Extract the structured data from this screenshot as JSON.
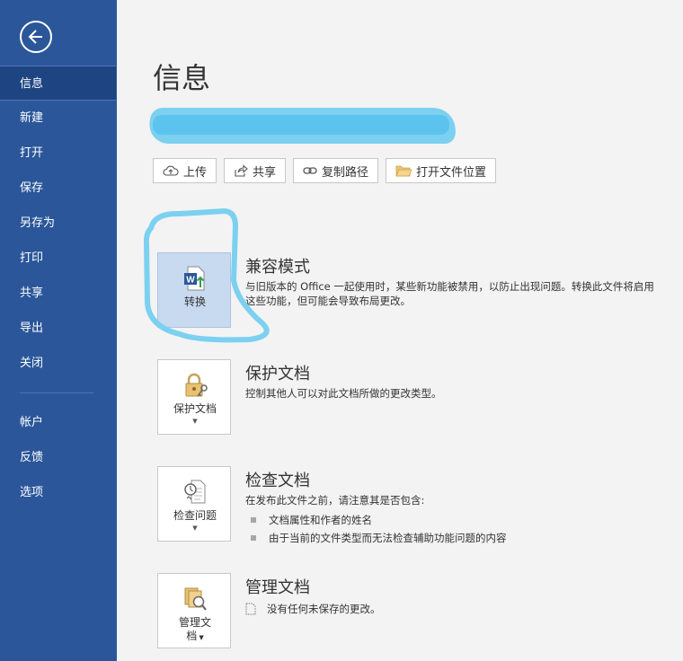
{
  "sidebar": {
    "items": [
      {
        "label": "信息",
        "active": true
      },
      {
        "label": "新建"
      },
      {
        "label": "打开"
      },
      {
        "label": "保存"
      },
      {
        "label": "另存为"
      },
      {
        "label": "打印"
      },
      {
        "label": "共享"
      },
      {
        "label": "导出"
      },
      {
        "label": "关闭"
      }
    ],
    "bottom_items": [
      {
        "label": "帐户"
      },
      {
        "label": "反馈"
      },
      {
        "label": "选项"
      }
    ]
  },
  "main": {
    "title": "信息",
    "actions": [
      {
        "label": "上传",
        "icon": "cloud-upload-icon"
      },
      {
        "label": "共享",
        "icon": "share-icon"
      },
      {
        "label": "复制路径",
        "icon": "link-icon"
      },
      {
        "label": "打开文件位置",
        "icon": "folder-icon"
      }
    ],
    "sections": {
      "compat": {
        "tile_label": "转换",
        "title": "兼容模式",
        "description": "与旧版本的 Office 一起使用时，某些新功能被禁用，以防止出现问题。转换此文件将启用这些功能，但可能会导致布局更改。"
      },
      "protect": {
        "tile_label": "保护文档",
        "title": "保护文档",
        "description": "控制其他人可以对此文档所做的更改类型。"
      },
      "inspect": {
        "tile_label": "检查问题",
        "title": "检查文档",
        "description": "在发布此文件之前，请注意其是否包含:",
        "bullets": [
          "文档属性和作者的姓名",
          "由于当前的文件类型而无法检查辅助功能问题的内容"
        ]
      },
      "manage": {
        "tile_label_line1": "管理文",
        "tile_label_line2": "档",
        "title": "管理文档",
        "note": "没有任何未保存的更改。"
      }
    }
  },
  "colors": {
    "sidebar": "#2b579a",
    "sidebar_active": "#1e4581",
    "background": "#f3f3f3",
    "highlight": "#7cd0f0"
  }
}
